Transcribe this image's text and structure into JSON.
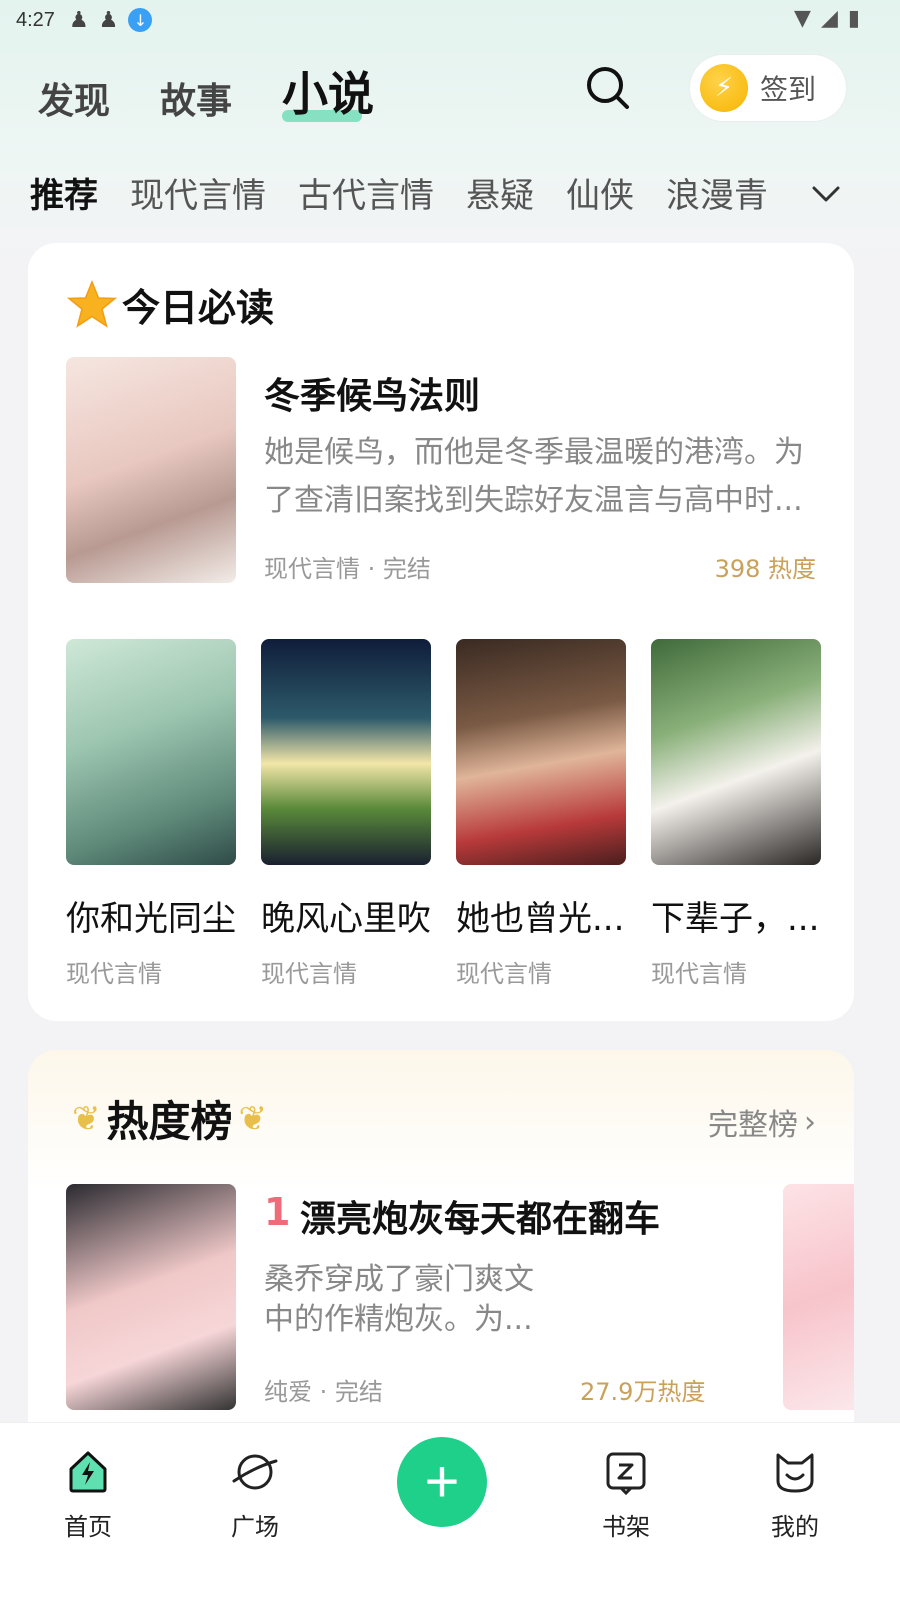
{
  "status_bar": {
    "time": "4:27"
  },
  "top_nav": {
    "tabs": [
      "发现",
      "故事",
      "小说"
    ],
    "active": "小说"
  },
  "checkin": {
    "label": "签到"
  },
  "categories": [
    "推荐",
    "现代言情",
    "古代言情",
    "悬疑",
    "仙侠",
    "浪漫青"
  ],
  "today": {
    "title": "今日必读",
    "featured": {
      "title": "冬季候鸟法则",
      "desc": "她是候鸟，而他是冬季最温暖的港湾。为了查清旧案找到失踪好友温言与高中时...",
      "meta": "现代言情 · 完结",
      "heat": "398 热度"
    },
    "books": [
      {
        "title": "你和光同尘",
        "category": "现代言情"
      },
      {
        "title": "晚风心里吹",
        "category": "现代言情"
      },
      {
        "title": "她也曾光...",
        "category": "现代言情"
      },
      {
        "title": "下辈子，...",
        "category": "现代言情"
      }
    ]
  },
  "hot": {
    "title": "热度榜",
    "full_rank": "完整榜",
    "item": {
      "rank": "1",
      "title": "漂亮炮灰每天都在翻车",
      "desc": "桑乔穿成了豪门爽文中的作精炮灰。为...",
      "meta": "纯爱 · 完结",
      "heat": "27.9万热度"
    }
  },
  "bottom_nav": {
    "home": "首页",
    "square": "广场",
    "shelf": "书架",
    "mine": "我的"
  },
  "colors": {
    "accent": "#1fd08a",
    "heat": "#c9a15a",
    "rank": "#f06b7a"
  }
}
